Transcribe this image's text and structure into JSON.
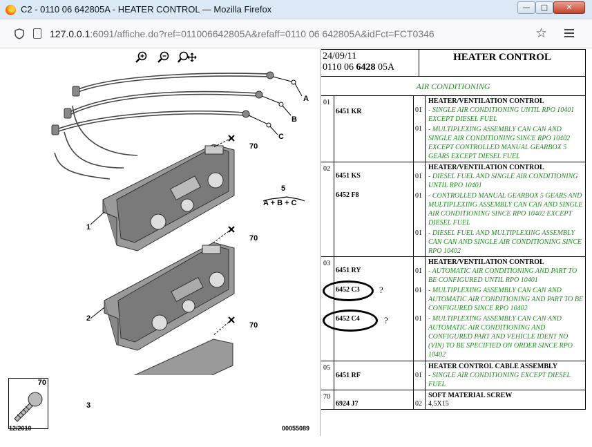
{
  "window": {
    "title": "C2 - 0110 06 642805A - HEATER CONTROL — Mozilla Firefox",
    "url_host": "127.0.0.1",
    "url_rest": ":6091/affiche.do?ref=011006642805A&refaff=0110 06 642805A&idFct=FCT0346",
    "controls": {
      "minimize": "—",
      "maximize": "□",
      "close": "✕"
    }
  },
  "diagram": {
    "callouts": {
      "a": "A",
      "b": "B",
      "c": "C",
      "n70a": "70",
      "n70b": "70",
      "n70c": "70",
      "n5": "5",
      "abc": "A + B + C",
      "n1": "1",
      "n2": "2",
      "n3": "3"
    },
    "legend_num": "70",
    "date_code": "12/2010",
    "drawing_ref": "00055089"
  },
  "header": {
    "date": "24/09/11",
    "code_prefix": "0110 06 ",
    "code_bold": "6428",
    "code_suffix": " 05A",
    "title": "HEATER CONTROL"
  },
  "section": "AIR CONDITIONING",
  "groups": [
    {
      "num": "01",
      "title": "HEATER/VENTILATION CONTROL",
      "refs": [
        "6451 KR"
      ],
      "lines": [
        {
          "qty": "01",
          "desc": "- SINGLE AIR CONDITIONING UNTIL RPO 10401 EXCEPT DIESEL FUEL"
        },
        {
          "qty": "01",
          "desc": "- MULTIPLEXING ASSEMBLY CAN CAN AND SINGLE AIR CONDITIONING SINCE RPO 10402 EXCEPT CONTROLLED MANUAL GEARBOX 5 GEARS EXCEPT DIESEL FUEL"
        }
      ]
    },
    {
      "num": "02",
      "title": "HEATER/VENTILATION CONTROL",
      "refs": [
        "6451 KS",
        "6452 F8"
      ],
      "lines": [
        {
          "qty": "01",
          "desc": "- DIESEL FUEL AND SINGLE AIR CONDITIONING UNTIL RPO 10401"
        },
        {
          "qty": "01",
          "desc": "- CONTROLLED MANUAL GEARBOX 5 GEARS AND MULTIPLEXING ASSEMBLY CAN CAN AND SINGLE AIR CONDITIONING SINCE RPO 10402 EXCEPT DIESEL FUEL"
        },
        {
          "qty": "01",
          "desc": "- DIESEL FUEL AND MULTIPLEXING ASSEMBLY CAN CAN AND SINGLE AIR CONDITIONING SINCE RPO 10402"
        }
      ]
    },
    {
      "num": "03",
      "title": "HEATER/VENTILATION CONTROL",
      "refs": [
        "6451 RY",
        "6452 C3",
        "6452 C4"
      ],
      "lines": [
        {
          "qty": "01",
          "desc": "- AUTOMATIC AIR CONDITIONING AND PART TO BE CONFIGURED UNTIL RPO 10401"
        },
        {
          "qty": "01",
          "desc": "- MULTIPLEXING ASSEMBLY CAN CAN AND AUTOMATIC AIR CONDITIONING AND PART TO BE CONFIGURED SINCE RPO 10402"
        },
        {
          "qty": "01",
          "desc": "- MULTIPLEXING ASSEMBLY CAN CAN AND AUTOMATIC AIR CONDITIONING AND CONFIGURED PART AND VEHICLE IDENT NO (VIN) TO BE SPECIFIED ON ORDER SINCE RPO 10402"
        }
      ],
      "marks": [
        "?",
        "?"
      ]
    },
    {
      "num": "05",
      "title": "HEATER CONTROL CABLE ASSEMBLY",
      "refs": [
        "6451 RF"
      ],
      "lines": [
        {
          "qty": "01",
          "desc": "- SINGLE AIR CONDITIONING EXCEPT DIESEL FUEL"
        }
      ]
    },
    {
      "num": "70",
      "title": "SOFT MATERIAL SCREW",
      "refs": [
        "6924 J7"
      ],
      "lines": [
        {
          "qty": "02",
          "desc": "4,5X15"
        }
      ]
    }
  ]
}
